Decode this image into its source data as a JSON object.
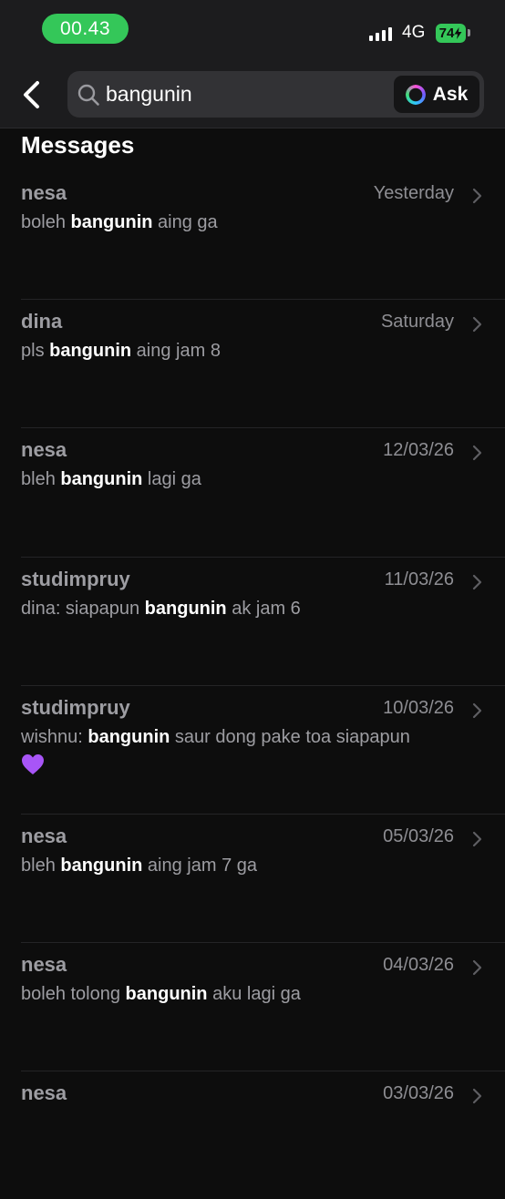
{
  "status_bar": {
    "time": "00.43",
    "network": "4G",
    "battery": "74"
  },
  "search": {
    "query": "bangunin",
    "ask_label": "Ask"
  },
  "section_title": "Messages",
  "results": [
    {
      "sender": "nesa",
      "date": "Yesterday",
      "before": "boleh ",
      "match": "bangunin",
      "after": " aing ga"
    },
    {
      "sender": "dina",
      "date": "Saturday",
      "before": "pls ",
      "match": "bangunin",
      "after": " aing jam 8"
    },
    {
      "sender": "nesa",
      "date": "12/03/26",
      "before": "bleh ",
      "match": "bangunin",
      "after": " lagi ga"
    },
    {
      "sender": "studimpruy",
      "date": "11/03/26",
      "before": "dina: siapapun ",
      "match": "bangunin",
      "after": " ak jam 6"
    },
    {
      "sender": "studimpruy",
      "date": "10/03/26",
      "before": "wishnu: ",
      "match": "bangunin",
      "after": " saur dong pake toa siapapun",
      "emoji": "purple-heart"
    },
    {
      "sender": "nesa",
      "date": "05/03/26",
      "before": "bleh ",
      "match": "bangunin",
      "after": " aing jam 7 ga"
    },
    {
      "sender": "nesa",
      "date": "04/03/26",
      "before": "boleh tolong ",
      "match": "bangunin",
      "after": " aku lagi ga"
    },
    {
      "sender": "nesa",
      "date": "03/03/26",
      "before": "",
      "match": "",
      "after": ""
    }
  ],
  "colors": {
    "accent_green": "#34c759",
    "background": "#0d0d0d",
    "header": "#1c1c1e",
    "heart": "#a855f7"
  }
}
